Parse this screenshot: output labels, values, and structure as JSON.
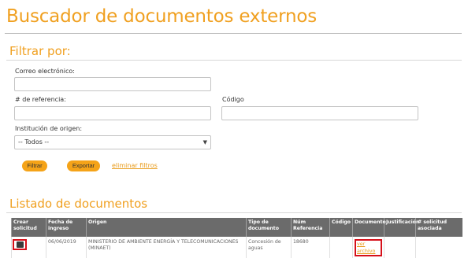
{
  "page": {
    "title": "Buscador de documentos externos"
  },
  "filters": {
    "section_title": "Filtrar por:",
    "email_label": "Correo electrónico:",
    "email_value": "",
    "reference_label": "# de referencia:",
    "reference_value": "",
    "code_label": "Código",
    "code_value": "",
    "institution_label": "Institución de origen:",
    "institution_selected": "-- Todos --",
    "filter_button": "Filtrar",
    "export_button": "Exportar",
    "clear_link": "eliminar filtros"
  },
  "list": {
    "section_title": "Listado de documentos",
    "columns": [
      "Crear solicitud",
      "Fecha de ingreso",
      "Origen",
      "Tipo de documento",
      "Núm Referencia",
      "Código",
      "Documento",
      "Justificación",
      "# solicitud asociada"
    ],
    "rows": [
      {
        "create_icon": "create-request-icon",
        "date": "06/06/2019",
        "origin": "MINISTERIO DE AMBIENTE ENERGÍA Y TELECOMUNICACIONES (MINAET)",
        "doc_type": "Concesión de aguas",
        "reference": "18680",
        "code": "",
        "document_link": "ver archivo",
        "justification": "",
        "associated_request": ""
      }
    ]
  },
  "colors": {
    "accent": "#f0a020",
    "button": "#f5a318",
    "header_bg": "#6b6b6b",
    "highlight": "#d6101a"
  }
}
